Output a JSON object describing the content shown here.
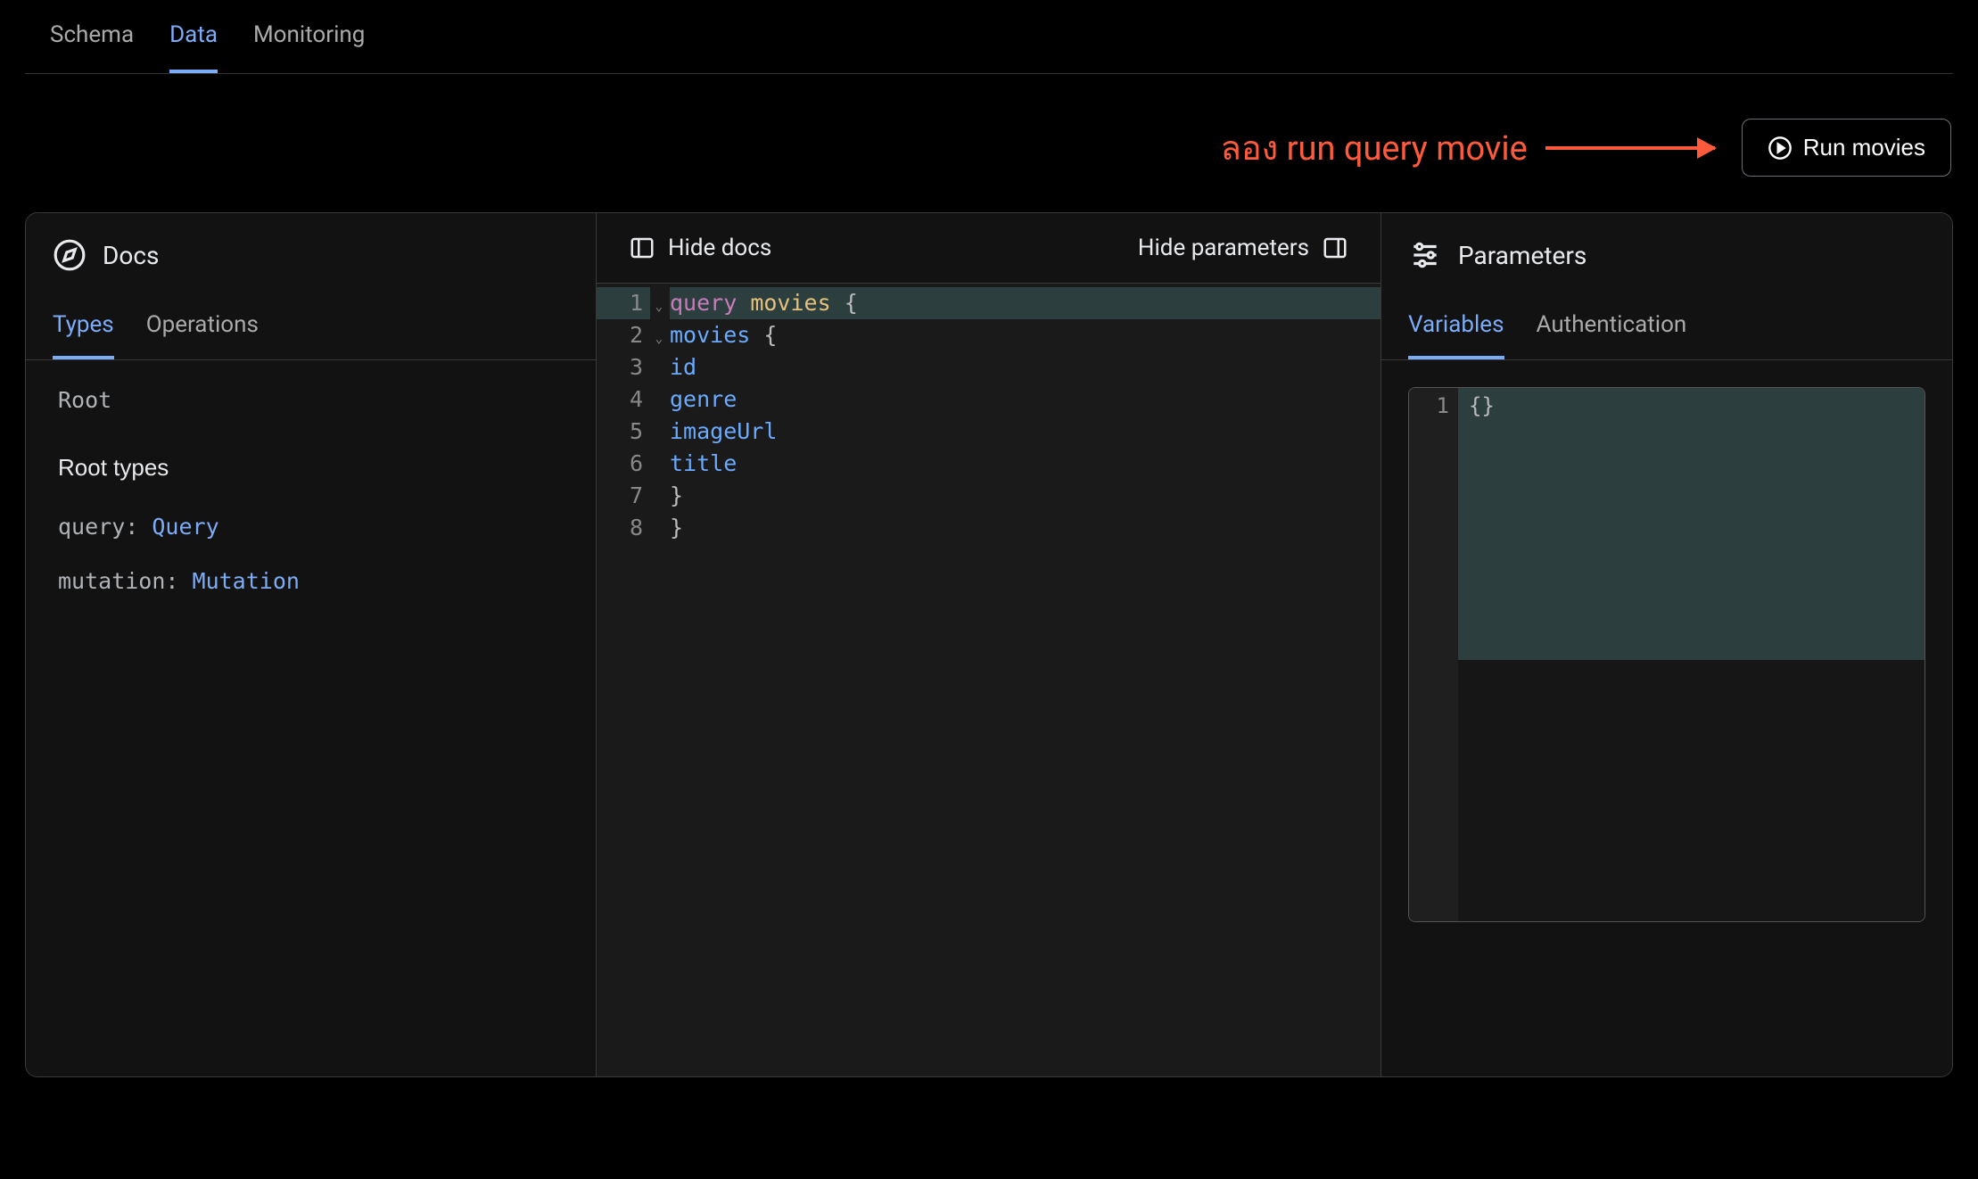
{
  "topTabs": [
    "Schema",
    "Data",
    "Monitoring"
  ],
  "topTabActive": 1,
  "annotation": "ลอง run query movie",
  "runButton": "Run movies",
  "docs": {
    "title": "Docs",
    "tabs": [
      "Types",
      "Operations"
    ],
    "tabActive": 0,
    "rootLabel": "Root",
    "rootTypesTitle": "Root types",
    "types": [
      {
        "key": "query",
        "value": "Query"
      },
      {
        "key": "mutation",
        "value": "Mutation"
      }
    ]
  },
  "editor": {
    "hideDocs": "Hide docs",
    "hideParams": "Hide parameters",
    "lines": [
      {
        "n": 1,
        "tokens": [
          [
            "kw",
            "query"
          ],
          [
            "sp",
            " "
          ],
          [
            "name",
            "movies"
          ],
          [
            "sp",
            " "
          ],
          [
            "brace",
            "{"
          ]
        ],
        "hl": true,
        "fold": true
      },
      {
        "n": 2,
        "tokens": [
          [
            "sp",
            "  "
          ],
          [
            "field",
            "movies"
          ],
          [
            "sp",
            " "
          ],
          [
            "brace",
            "{"
          ]
        ],
        "fold": true
      },
      {
        "n": 3,
        "tokens": [
          [
            "sp",
            "    "
          ],
          [
            "field",
            "id"
          ]
        ]
      },
      {
        "n": 4,
        "tokens": [
          [
            "sp",
            "    "
          ],
          [
            "field",
            "genre"
          ]
        ]
      },
      {
        "n": 5,
        "tokens": [
          [
            "sp",
            "    "
          ],
          [
            "field",
            "imageUrl"
          ]
        ]
      },
      {
        "n": 6,
        "tokens": [
          [
            "sp",
            "    "
          ],
          [
            "field",
            "title"
          ]
        ]
      },
      {
        "n": 7,
        "tokens": [
          [
            "sp",
            "  "
          ],
          [
            "brace",
            "}"
          ]
        ]
      },
      {
        "n": 8,
        "tokens": [
          [
            "brace",
            "}"
          ]
        ]
      }
    ]
  },
  "params": {
    "title": "Parameters",
    "tabs": [
      "Variables",
      "Authentication"
    ],
    "tabActive": 0,
    "variables": {
      "line": 1,
      "content": "{}"
    }
  }
}
